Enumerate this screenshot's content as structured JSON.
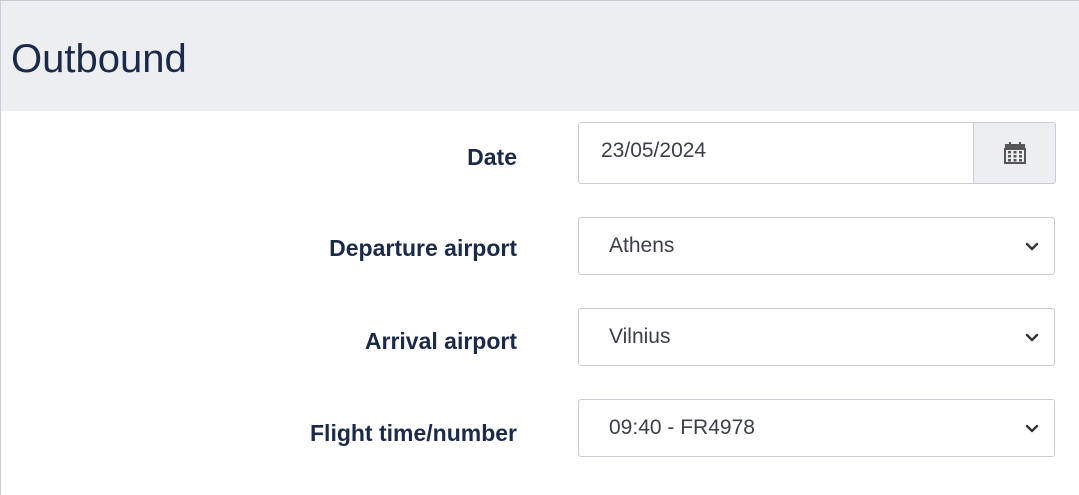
{
  "section": {
    "title": "Outbound"
  },
  "form": {
    "date": {
      "label": "Date",
      "value": "23/05/2024"
    },
    "departure": {
      "label": "Departure airport",
      "value": "Athens"
    },
    "arrival": {
      "label": "Arrival airport",
      "value": "Vilnius"
    },
    "flight": {
      "label": "Flight time/number",
      "value": "09:40 - FR4978"
    }
  },
  "icons": {
    "calendar": "calendar-icon",
    "dropdown": "chevron-down-icon"
  },
  "colors": {
    "header_bg": "#eceef1",
    "label_text": "#1c2a4a",
    "field_border": "#c9ccd2"
  }
}
